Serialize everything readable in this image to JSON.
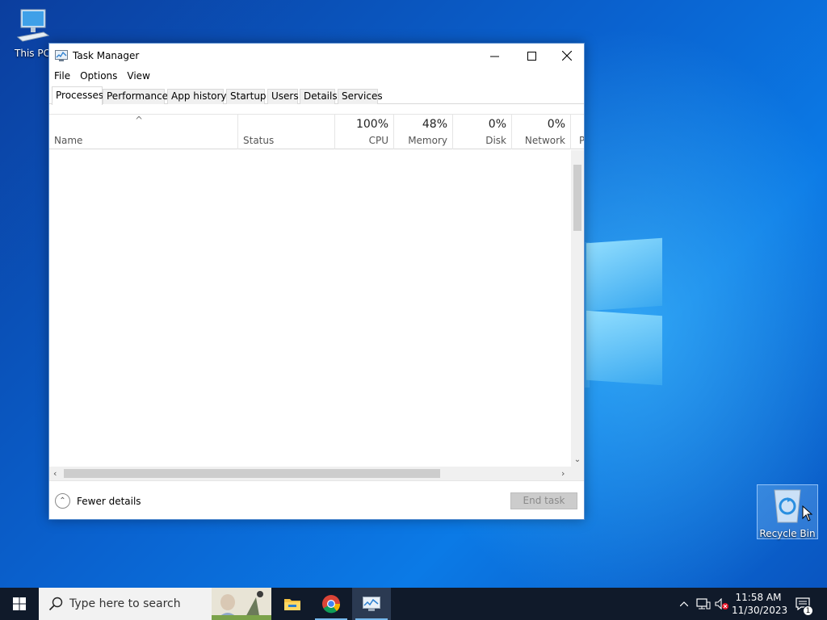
{
  "desktop": {
    "icons": [
      {
        "label": "This PC",
        "icon": "computer-icon"
      },
      {
        "label": "Recycle Bin",
        "icon": "recycle-bin-icon"
      }
    ]
  },
  "window": {
    "title": "Task Manager",
    "menu": [
      "File",
      "Options",
      "View"
    ],
    "tabs": [
      "Processes",
      "Performance",
      "App history",
      "Startup",
      "Users",
      "Details",
      "Services"
    ],
    "active_tab": "Processes",
    "columns": [
      {
        "name": "Name",
        "value": ""
      },
      {
        "name": "Status",
        "value": ""
      },
      {
        "name": "CPU",
        "value": "100%"
      },
      {
        "name": "Memory",
        "value": "48%"
      },
      {
        "name": "Disk",
        "value": "0%"
      },
      {
        "name": "Network",
        "value": "0%"
      },
      {
        "name": "P",
        "value": ""
      }
    ],
    "footer": {
      "fewer_details": "Fewer details",
      "end_task": "End task"
    }
  },
  "taskbar": {
    "search_placeholder": "Type here to search",
    "apps": [
      "file-explorer-icon",
      "chrome-icon",
      "task-manager-icon"
    ],
    "clock": {
      "time": "11:58 AM",
      "date": "11/30/2023"
    },
    "notification_count": "1"
  },
  "colors": {
    "accent": "#0078d7",
    "taskbar": "#101a2a",
    "window_border": "#5a8fd0"
  }
}
